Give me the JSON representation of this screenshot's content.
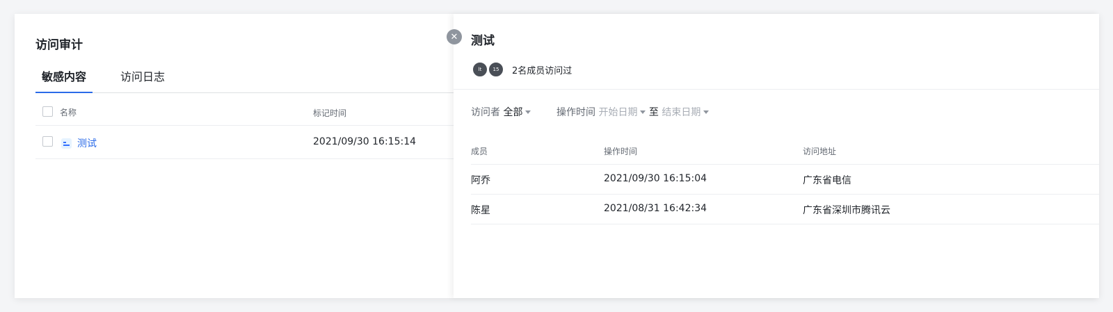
{
  "left": {
    "title": "访问审计",
    "tabs": [
      {
        "label": "敏感内容",
        "active": true
      },
      {
        "label": "访问日志",
        "active": false
      }
    ],
    "columns": {
      "name": "名称",
      "marked_time": "标记时间"
    },
    "rows": [
      {
        "name": "测试",
        "marked_time": "2021/09/30 16:15:14",
        "icon": "doc-list-icon"
      }
    ]
  },
  "drawer": {
    "title": "测试",
    "close_icon": "close-icon",
    "avatars": [
      "lt",
      "15"
    ],
    "visitors_text": "2名成员访问过",
    "filters": {
      "visitor_label": "访问者",
      "visitor_value": "全部",
      "time_label": "操作时间",
      "start_placeholder": "开始日期",
      "to": "至",
      "end_placeholder": "结束日期"
    },
    "columns": {
      "member": "成员",
      "time": "操作时间",
      "location": "访问地址"
    },
    "rows": [
      {
        "member": "阿乔",
        "time": "2021/09/30 16:15:04",
        "location": "广东省电信"
      },
      {
        "member": "陈星",
        "time": "2021/08/31 16:42:34",
        "location": "广东省深圳市腾讯云"
      }
    ]
  },
  "colors": {
    "accent": "#2a6ae8",
    "text": "#1f2329",
    "muted": "#646a73",
    "placeholder": "#a8adb5"
  }
}
